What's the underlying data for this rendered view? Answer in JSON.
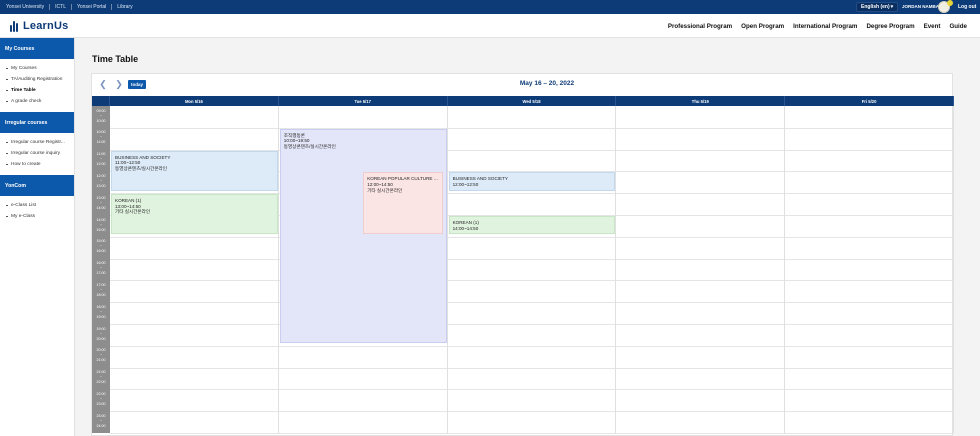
{
  "utility": {
    "links": [
      "Yonsei University",
      "ICTL",
      "Yonsei Portal",
      "Library"
    ],
    "language": "English (en)",
    "username": "JORDAN NAMBA",
    "logout": "Log out"
  },
  "header": {
    "logo_text": "LearnUs",
    "nav": [
      "Professional Program",
      "Open Program",
      "International Program",
      "Degree Program",
      "Event",
      "Guide"
    ]
  },
  "sidebar": {
    "sections": [
      {
        "title": "My Courses",
        "items": [
          "My Courses",
          "TA/Auditing Registration",
          "Time Table",
          "A grade check"
        ]
      },
      {
        "title": "Irregular courses",
        "items": [
          "Irregular course Registr...",
          "Irregular course inquiry",
          "How to create"
        ]
      },
      {
        "title": "YonCom",
        "items": [
          "e-Class List",
          "My e-Class"
        ]
      }
    ]
  },
  "page": {
    "title": "Time Table"
  },
  "timetable": {
    "today_label": "today",
    "range": "May 16 – 20, 2022",
    "days": [
      "Mon 5/16",
      "Tue 5/17",
      "Wed 5/18",
      "Thu 5/19",
      "Fri 5/20"
    ],
    "slots": [
      [
        "09:00",
        "10:00"
      ],
      [
        "10:00",
        "11:00"
      ],
      [
        "11:00",
        "12:00"
      ],
      [
        "12:00",
        "13:00"
      ],
      [
        "13:00",
        "14:00"
      ],
      [
        "14:00",
        "15:00"
      ],
      [
        "15:00",
        "16:00"
      ],
      [
        "16:00",
        "17:00"
      ],
      [
        "17:00",
        "18:00"
      ],
      [
        "18:00",
        "19:00"
      ],
      [
        "19:00",
        "20:00"
      ],
      [
        "20:00",
        "21:00"
      ],
      [
        "21:00",
        "22:00"
      ],
      [
        "22:00",
        "23:00"
      ],
      [
        "23:00",
        "24:00"
      ]
    ],
    "events": [
      {
        "day": 1,
        "start": 10.0,
        "end": 19.833,
        "title": "조직행동론",
        "time": "10:00~19:50",
        "mode": "동영상콘텐츠/실시간온라인",
        "color": "purple"
      },
      {
        "day": 0,
        "start": 11.0,
        "end": 12.833,
        "title": "BUSINESS AND SOCIETY",
        "time": "11:00~12:50",
        "mode": "동영상콘텐츠/실시간온라인",
        "color": "blue"
      },
      {
        "day": 0,
        "start": 13.0,
        "end": 14.833,
        "title": "KOREAN (1)",
        "time": "13:00~14:50",
        "mode": "기타 실시간온라인",
        "color": "green"
      },
      {
        "day": 1,
        "start": 12.0,
        "end": 14.833,
        "title": "KOREAN POPULAR CULTURE AN...",
        "time": "12:00~14:50",
        "mode": "기타 실시간온라인",
        "color": "pink",
        "half": "right"
      },
      {
        "day": 2,
        "start": 12.0,
        "end": 12.833,
        "title": "BUSINESS AND SOCIETY",
        "time": "12:00~12:50",
        "mode": "",
        "color": "blue"
      },
      {
        "day": 2,
        "start": 14.0,
        "end": 14.833,
        "title": "KOREAN (1)",
        "time": "14:00~14:50",
        "mode": "",
        "color": "green"
      }
    ]
  }
}
